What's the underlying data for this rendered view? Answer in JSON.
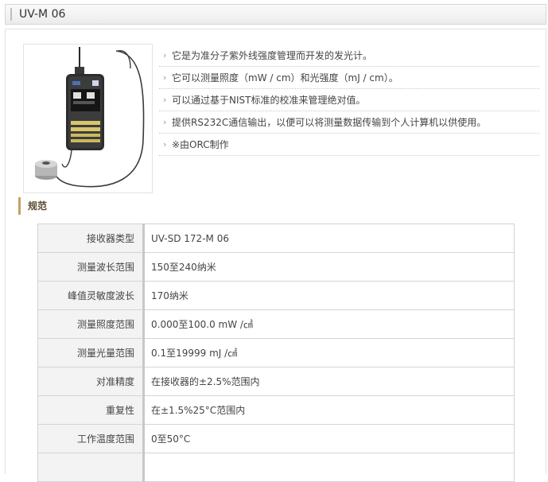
{
  "header": {
    "title": "UV-M 06"
  },
  "product": {
    "features": [
      "它是为准分子紫外线强度管理而开发的发光计。",
      "它可以测量照度（mW / cm）和光强度（mJ / cm）。",
      "可以通过基于NIST标准的校准来管理绝对值。",
      "提供RS232C通信输出，以便可以将测量数据传输到个人计算机以供使用。",
      "※由ORC制作"
    ]
  },
  "specs": {
    "heading": "规范",
    "rows": [
      {
        "label": "接收器类型",
        "value": "UV-SD 172-M 06"
      },
      {
        "label": "测量波长范围",
        "value": "150至240纳米"
      },
      {
        "label": "峰值灵敏度波长",
        "value": "170纳米"
      },
      {
        "label": "测量照度范围",
        "value": "0.000至100.0 mW /㎠"
      },
      {
        "label": "测量光量范围",
        "value": "0.1至19999 mJ /㎠"
      },
      {
        "label": "对准精度",
        "value": "在接收器的±2.5%范围内"
      },
      {
        "label": "重复性",
        "value": "在±1.5%25°C范围内"
      },
      {
        "label": "工作温度范围",
        "value": "0至50°C"
      },
      {
        "label": "",
        "value": ""
      }
    ]
  }
}
